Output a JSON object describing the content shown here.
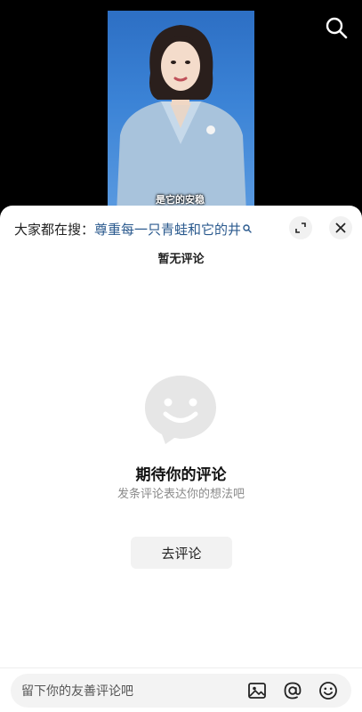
{
  "video": {
    "subtitle": "是它的安稳"
  },
  "header": {
    "search_button_icon": "search-icon"
  },
  "comment_sheet": {
    "hot_search_prefix": "大家都在搜：",
    "hot_search_query": "尊重每一只青蛙和它的井",
    "hot_search_icon": "magnifier-icon",
    "expand_icon": "expand-icon",
    "close_icon": "close-icon",
    "no_comments_label": "暂无评论",
    "empty_state": {
      "illustration": "smiley-chat-bubble-icon",
      "title": "期待你的评论",
      "subtitle": "发条评论表达你的想法吧"
    },
    "go_comment_button": "去评论",
    "input": {
      "placeholder": "留下你的友善评论吧",
      "value": "",
      "icons": [
        "image-icon",
        "at-icon",
        "emoji-icon"
      ]
    }
  },
  "colors": {
    "link": "#2b5a8e",
    "sheet_background": "#ffffff",
    "input_background": "#f3f3f3"
  }
}
